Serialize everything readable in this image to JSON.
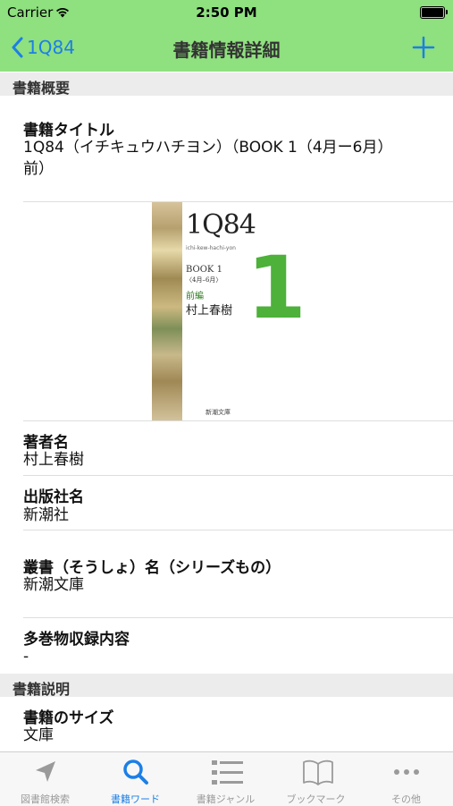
{
  "status": {
    "carrier": "Carrier",
    "time": "2:50 PM"
  },
  "nav": {
    "back_label": "1Q84",
    "title": "書籍情報詳細"
  },
  "sections": {
    "overview": "書籍概要",
    "description": "書籍説明"
  },
  "fields": {
    "title_label": "書籍タイトル",
    "title_value_line1": "1Q84（イチキュウハチヨン）（BOOK 1（4月ー6月）",
    "title_value_line2": "前）",
    "author_label": "著者名",
    "author_value": "村上春樹",
    "publisher_label": "出版社名",
    "publisher_value": "新潮社",
    "series_label": "叢書（そうしょ）名（シリーズもの）",
    "series_value": "新潮文庫",
    "volumes_label": "多巻物収録内容",
    "volumes_value": "-",
    "size_label": "書籍のサイズ",
    "size_value": "文庫"
  },
  "cover": {
    "title": "1Q84",
    "subtitle": "ichi-kew-hachi-yon",
    "book_line": "BOOK 1",
    "months": "〈4月–6月〉",
    "part": "前編",
    "author": "村上春樹",
    "big_number": "1",
    "publisher": "新潮文庫"
  },
  "tabs": [
    {
      "label": "図書館検索",
      "icon": "location-arrow-icon",
      "active": false
    },
    {
      "label": "書籍ワード",
      "icon": "search-icon",
      "active": true
    },
    {
      "label": "書籍ジャンル",
      "icon": "list-icon",
      "active": false
    },
    {
      "label": "ブックマーク",
      "icon": "book-icon",
      "active": false
    },
    {
      "label": "その他",
      "icon": "more-icon",
      "active": false
    }
  ],
  "colors": {
    "nav_bg": "#8fe07f",
    "accent": "#1c7fe6",
    "tab_inactive": "#9a9a9a"
  }
}
